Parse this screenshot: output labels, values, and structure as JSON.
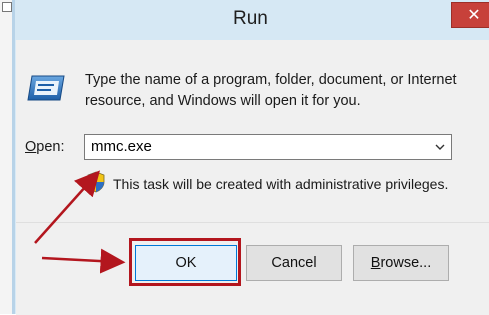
{
  "window": {
    "title": "Run",
    "close_glyph": "✕"
  },
  "dialog": {
    "description": "Type the name of a program, folder, document, or Internet resource, and Windows will open it for you.",
    "open_label_accel": "O",
    "open_label_rest": "pen:",
    "open_value": "mmc.exe",
    "admin_note": "This task will be created with administrative privileges."
  },
  "buttons": {
    "ok": "OK",
    "cancel": "Cancel",
    "browse_accel": "B",
    "browse_rest": "rowse..."
  },
  "annotations": {
    "arrow_color": "#b3161e",
    "highlight_color": "#b3161e"
  },
  "icons": {
    "run_icon": "run-program-icon",
    "shield_icon": "uac-shield-icon",
    "dropdown_icon": "chevron-down-icon",
    "close_icon": "close-icon"
  }
}
